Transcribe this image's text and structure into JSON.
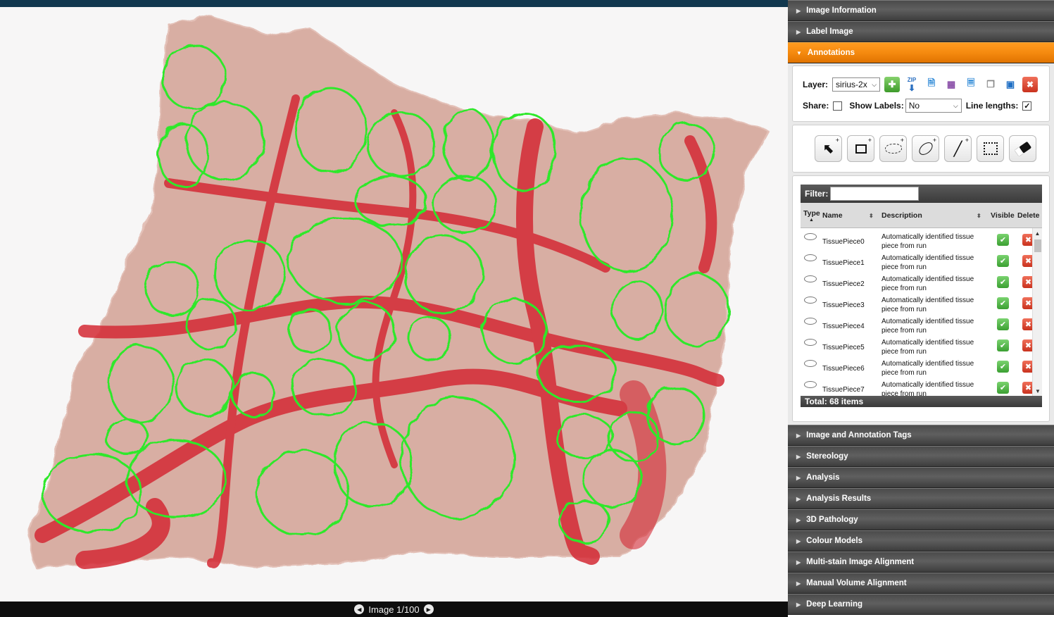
{
  "viewer": {
    "nav_label": "Image 1/100",
    "prev_icon": "left-arrow-circle",
    "next_icon": "right-arrow-circle"
  },
  "panel": {
    "sections_top": [
      {
        "label": "Image Information"
      },
      {
        "label": "Label Image"
      }
    ],
    "active_section": {
      "label": "Annotations",
      "color": "#f58a0f"
    },
    "layer": {
      "label": "Layer:",
      "value": "sirius-2x",
      "share_label": "Share:",
      "share_checked": false,
      "show_labels_label": "Show Labels:",
      "show_labels_value": "No",
      "line_lengths_label": "Line lengths:",
      "line_lengths_checked": true,
      "check_mark": "✓",
      "zip_text": "ZIP"
    },
    "tools": [
      {
        "name": "select-arrow-tool",
        "icon": "arrow-icon"
      },
      {
        "name": "rectangle-tool",
        "icon": "rectangle-icon"
      },
      {
        "name": "freehand-tool",
        "icon": "freehand-icon"
      },
      {
        "name": "ellipse-tool",
        "icon": "ellipse-icon"
      },
      {
        "name": "line-tool",
        "icon": "line-icon"
      },
      {
        "name": "selection-tool",
        "icon": "dotted-rectangle-icon"
      },
      {
        "name": "eraser-tool",
        "icon": "eraser-icon"
      }
    ],
    "list": {
      "filter_label": "Filter:",
      "filter_value": "",
      "columns": {
        "type": "Type",
        "name": "Name",
        "description": "Description",
        "visible": "Visible",
        "delete": "Delete"
      },
      "rows": [
        {
          "name": "TissuePiece0",
          "description": "Automatically identified tissue piece from run"
        },
        {
          "name": "TissuePiece1",
          "description": "Automatically identified tissue piece from run"
        },
        {
          "name": "TissuePiece2",
          "description": "Automatically identified tissue piece from run"
        },
        {
          "name": "TissuePiece3",
          "description": "Automatically identified tissue piece from run"
        },
        {
          "name": "TissuePiece4",
          "description": "Automatically identified tissue piece from run"
        },
        {
          "name": "TissuePiece5",
          "description": "Automatically identified tissue piece from run"
        },
        {
          "name": "TissuePiece6",
          "description": "Automatically identified tissue piece from run"
        },
        {
          "name": "TissuePiece7",
          "description": "Automatically identified tissue piece from run"
        }
      ],
      "total": "Total: 68 items"
    },
    "sections_bottom": [
      {
        "label": "Image and Annotation Tags"
      },
      {
        "label": "Stereology"
      },
      {
        "label": "Analysis"
      },
      {
        "label": "Analysis Results"
      },
      {
        "label": "3D Pathology"
      },
      {
        "label": "Colour Models"
      },
      {
        "label": "Multi-stain Image Alignment"
      },
      {
        "label": "Manual Volume Alignment"
      },
      {
        "label": "Deep Learning"
      }
    ]
  },
  "colors": {
    "top_bar": "#12384f",
    "tissue": "#d8aea3",
    "fibrosis": "#d42a35",
    "annotation_outline": "#2ee82a"
  }
}
